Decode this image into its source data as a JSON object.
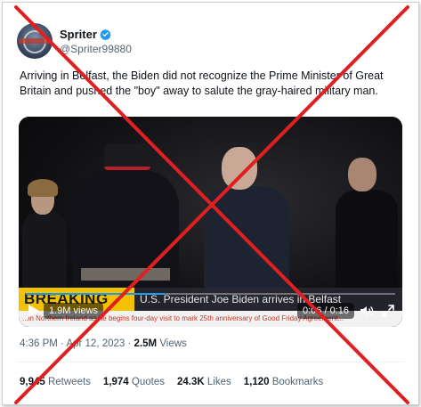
{
  "author": {
    "display_name": "Spriter",
    "handle": "@Spriter99880",
    "avatar_icon": "globe-avatar",
    "verified_icon": "verified-badge-icon",
    "verified_color": "#1d9bf0"
  },
  "tweet": {
    "text": "Arriving in Belfast, the Biden did not recognize the Prime Minister of Great Britain and pushed the \"boy\" away to salute the gray-haired military man."
  },
  "video": {
    "breaking_label": "BREAKING NEWS",
    "headline": "U.S. President Joe Biden arrives in Belfast",
    "subline": "...in Northern Ireland as he begins four-day visit to mark 25th anniversary of Good Friday Agreement...",
    "views": "1.9M views",
    "time": "0:06 / 0:16",
    "progress": 0.375,
    "play_icon": "play-icon",
    "volume_icon": "volume-icon",
    "fullscreen_icon": "fullscreen-icon"
  },
  "meta": {
    "time": "4:36 PM",
    "separator": "·",
    "date": "Apr 12, 2023",
    "views_count": "2.5M",
    "views_label": "Views"
  },
  "stats": {
    "retweets_count": "9,945",
    "retweets_label": "Retweets",
    "quotes_count": "1,974",
    "quotes_label": "Quotes",
    "likes_count": "24.3K",
    "likes_label": "Likes",
    "bookmarks_count": "1,120",
    "bookmarks_label": "Bookmarks"
  },
  "overlay": {
    "cross_color": "#e02020",
    "cross_icon": "red-x-mark"
  }
}
